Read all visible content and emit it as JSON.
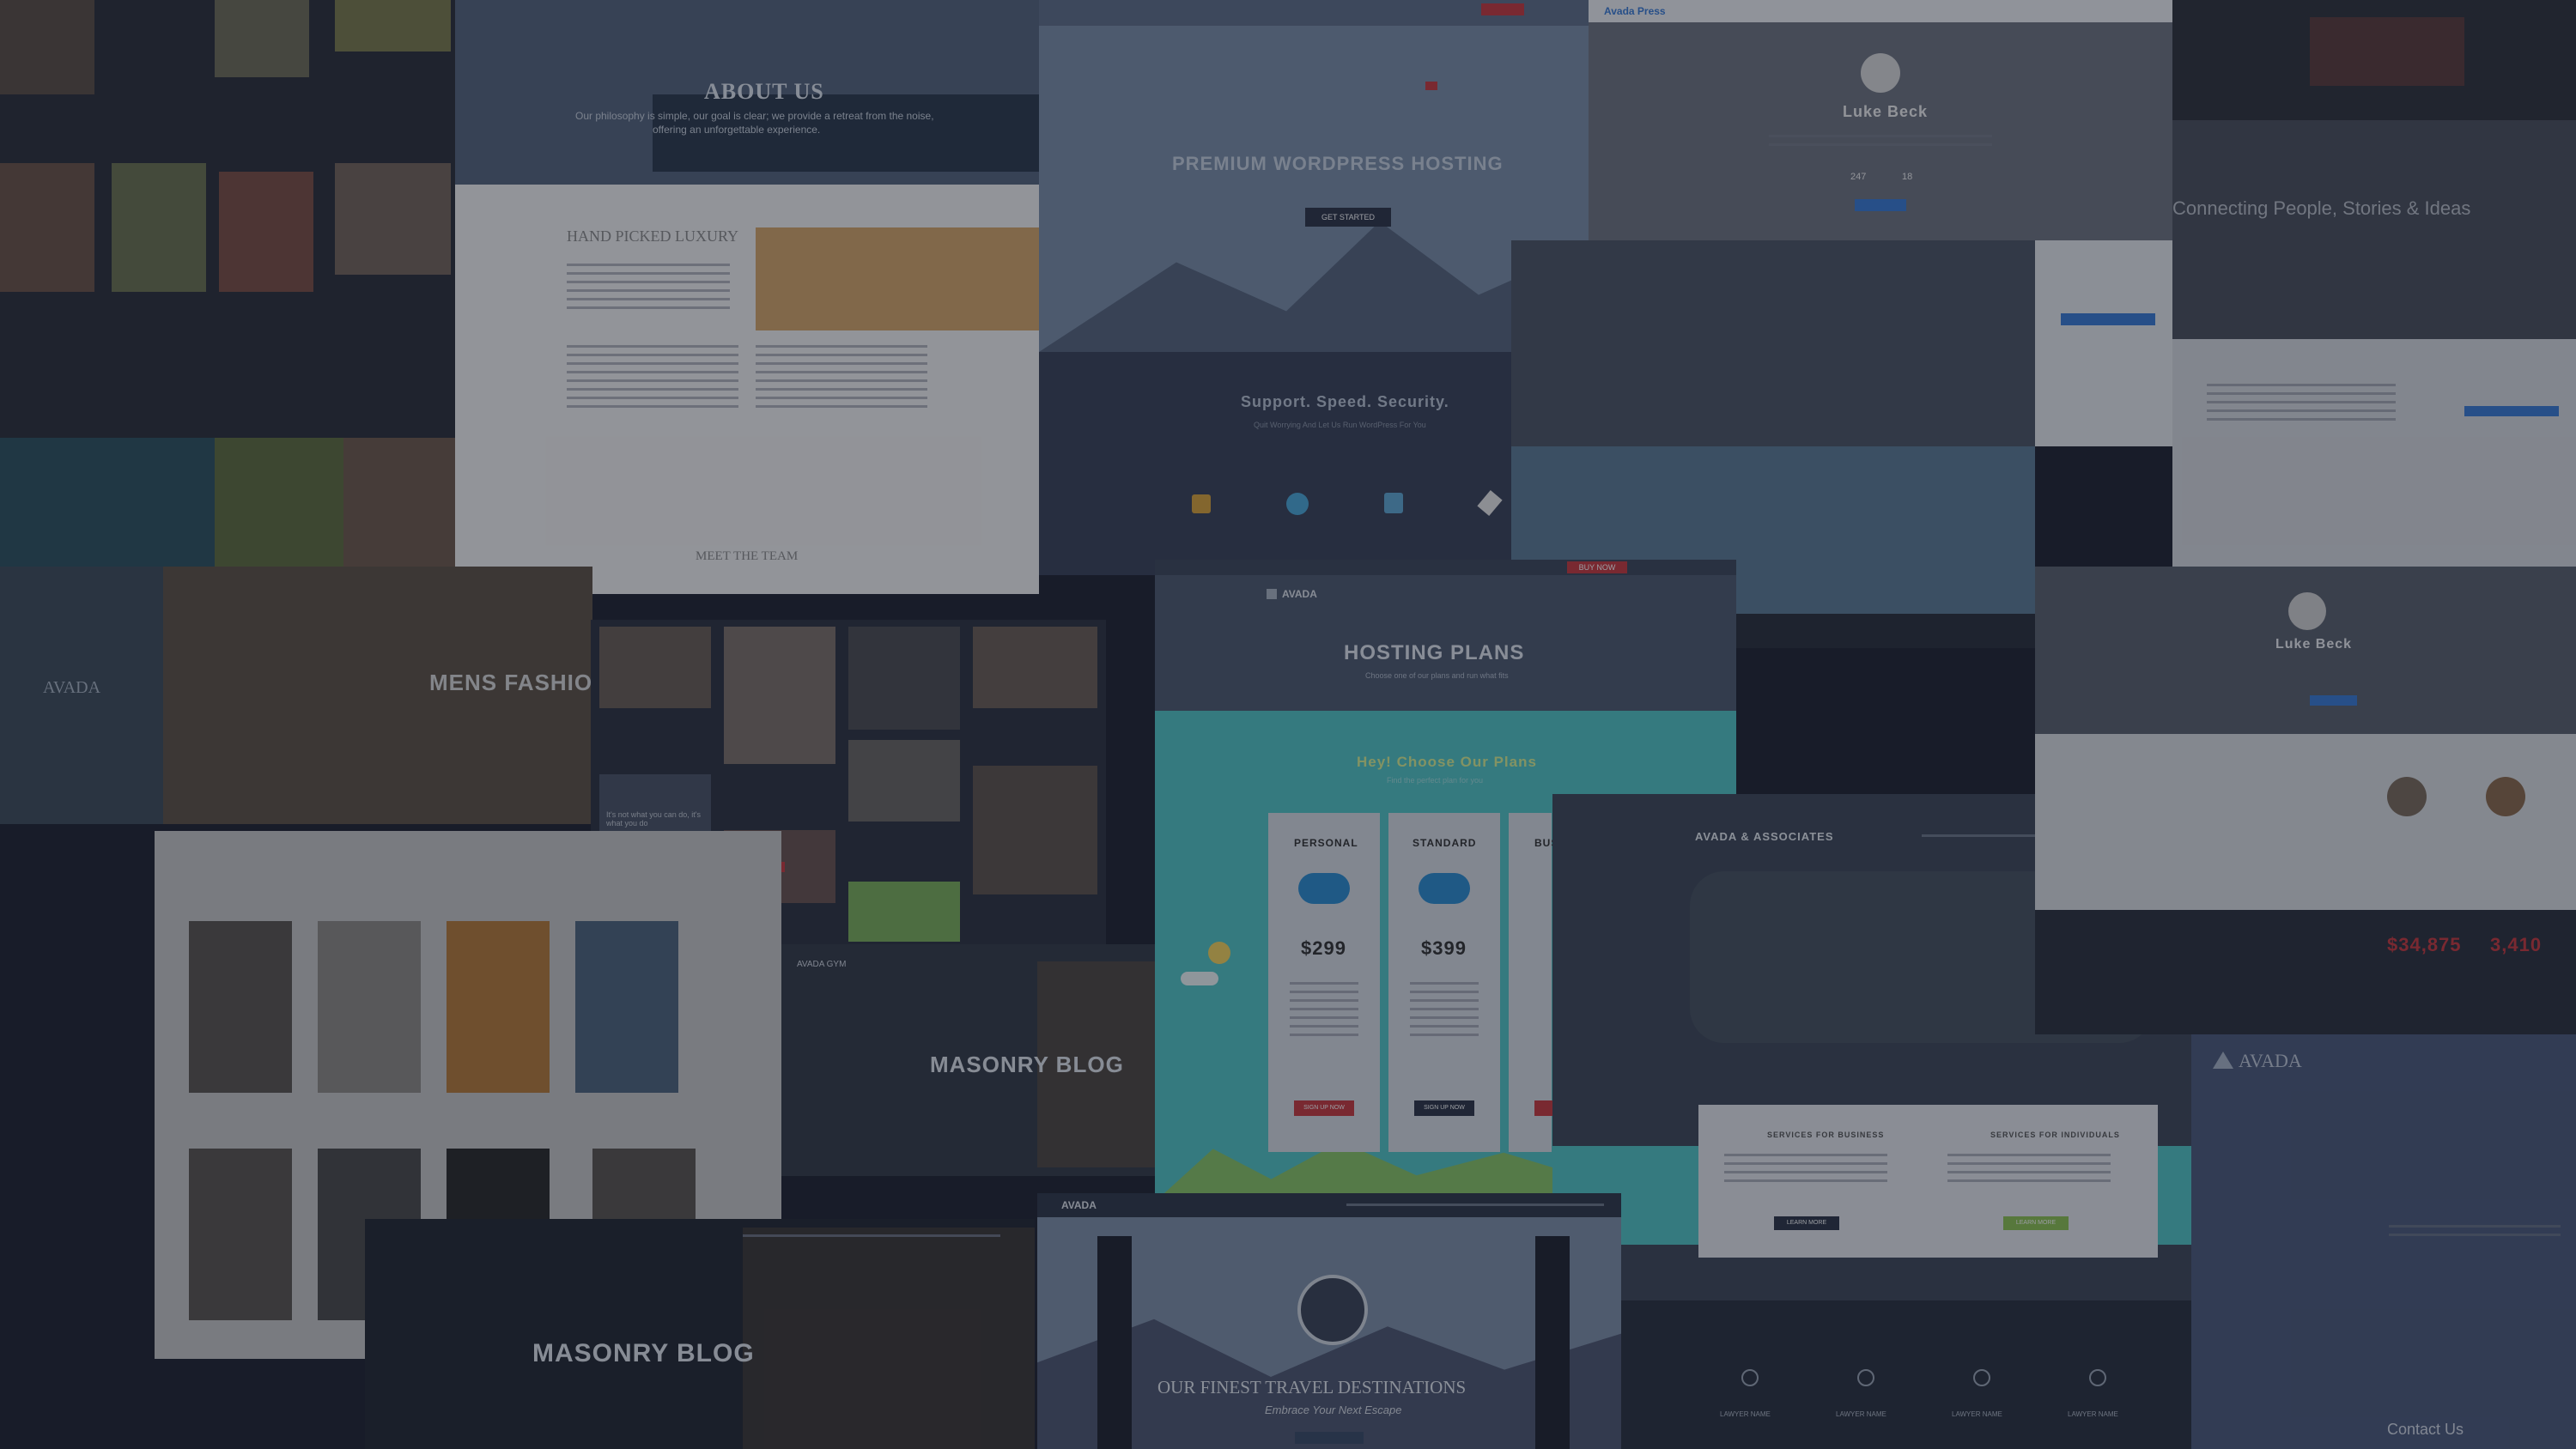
{
  "about": {
    "title": "ABOUT US",
    "subtitle_line1": "Our philosophy is simple, our goal is clear; we provide a retreat from the noise,",
    "subtitle_line2": "offering an unforgettable experience.",
    "section_title": "HAND PICKED LUXURY",
    "team_title": "MEET THE TEAM"
  },
  "hosting_hero": {
    "title": "PREMIUM WORDPRESS HOSTING",
    "button": "GET STARTED",
    "features_title": "Support. Speed. Security.",
    "features_subtitle": "Quit Worrying And Let Us Run WordPress For You",
    "feature_icons": [
      "lock-icon",
      "globe-icon",
      "thumbs-up-icon",
      "rocket-icon"
    ]
  },
  "profile": {
    "brand": "Avada Press",
    "name": "Luke Beck",
    "stat1": "247",
    "stat2": "18",
    "name2": "Luke Beck",
    "tagline": "Connecting People, Stories & Ideas"
  },
  "mens": {
    "title": "MENS FASHION"
  },
  "gym": {
    "quote": "It's not what you can do, it's what you do"
  },
  "masonry": {
    "title1": "MASONRY BLOG",
    "title2": "MASONRY BLOG",
    "logo": "AVADA GYM"
  },
  "plans": {
    "brand": "AVADA",
    "cta": "BUY NOW",
    "title": "HOSTING PLANS",
    "subtitle": "Choose one of our plans and run what fits",
    "choose": "Hey! Choose Our Plans",
    "choose_sub": "Find the perfect plan for you",
    "items": [
      {
        "name": "PERSONAL",
        "price": "$299",
        "button": "SIGN UP NOW"
      },
      {
        "name": "STANDARD",
        "price": "$399",
        "button": "SIGN UP NOW"
      },
      {
        "name": "BUSINESS"
      }
    ]
  },
  "law": {
    "title": "AVADA & ASSOCIATES",
    "services1": "SERVICES FOR BUSINESS",
    "services2": "SERVICES FOR INDIVIDUALS",
    "btn1": "LEARN MORE",
    "btn2": "LEARN MORE",
    "labels": [
      "LAWYER NAME",
      "LAWYER NAME",
      "LAWYER NAME",
      "LAWYER NAME"
    ]
  },
  "travel": {
    "brand": "AVADA",
    "title": "OUR FINEST TRAVEL DESTINATIONS",
    "subtitle": "Embrace Your Next Escape"
  },
  "right": {
    "brand": "AVADA",
    "stat1": "$34,875",
    "stat2": "3,410",
    "contact": "Contact Us"
  },
  "left_logo": "AVADA",
  "colors": {
    "accent_red": "#c6393f",
    "teal": "#52c4c5",
    "green": "#8cc152",
    "blue": "#3a7bd5"
  }
}
